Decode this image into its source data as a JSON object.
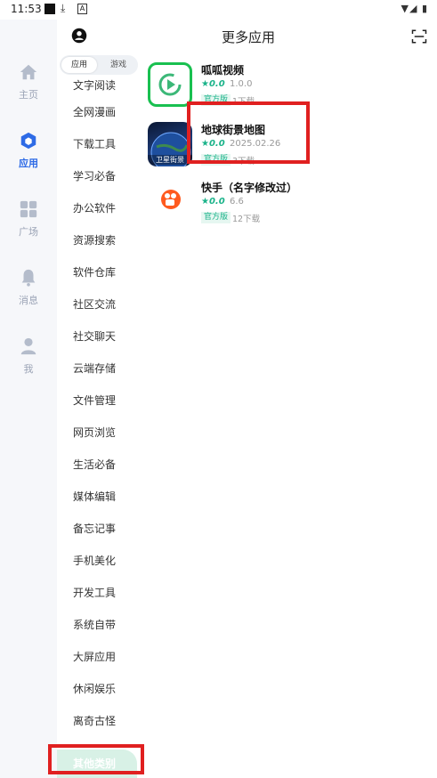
{
  "status_bar": {
    "time": "11:53",
    "right_icons": "▼◢ ▮"
  },
  "nav": {
    "items": [
      {
        "label": "主页",
        "icon": "home-icon"
      },
      {
        "label": "应用",
        "icon": "apps-cube-icon"
      },
      {
        "label": "广场",
        "icon": "grid-icon"
      },
      {
        "label": "消息",
        "icon": "bell-icon"
      },
      {
        "label": "我",
        "icon": "person-icon"
      }
    ]
  },
  "header": {
    "title": "更多应用"
  },
  "segment": {
    "apps": "应用",
    "games": "游戏"
  },
  "categories": [
    "文字阅读",
    "全网漫画",
    "下载工具",
    "学习必备",
    "办公软件",
    "资源搜索",
    "软件仓库",
    "社区交流",
    "社交聊天",
    "云端存储",
    "文件管理",
    "网页浏览",
    "生活必备",
    "媒体编辑",
    "备忘记事",
    "手机美化",
    "开发工具",
    "系统自带",
    "大屏应用",
    "休闲娱乐",
    "离奇古怪"
  ],
  "active_category": "其他类别",
  "apps": [
    {
      "name": "呱呱视频",
      "rating": "★0.0",
      "version": "1.0.0",
      "tag": "官方版",
      "downloads": "1下载"
    },
    {
      "name": "地球街景地图",
      "rating": "★0.0",
      "version": "2025.02.26",
      "tag": "官方版",
      "downloads": "3下载",
      "icon_text": "卫星街景"
    },
    {
      "name": "快手（名字修改过）",
      "rating": "★0.0",
      "version": "6.6",
      "tag": "官方版",
      "downloads": "12下载"
    }
  ],
  "colors": {
    "accent_blue": "#2e6be6",
    "green": "#1bb38a",
    "highlight_red": "#e02020"
  }
}
